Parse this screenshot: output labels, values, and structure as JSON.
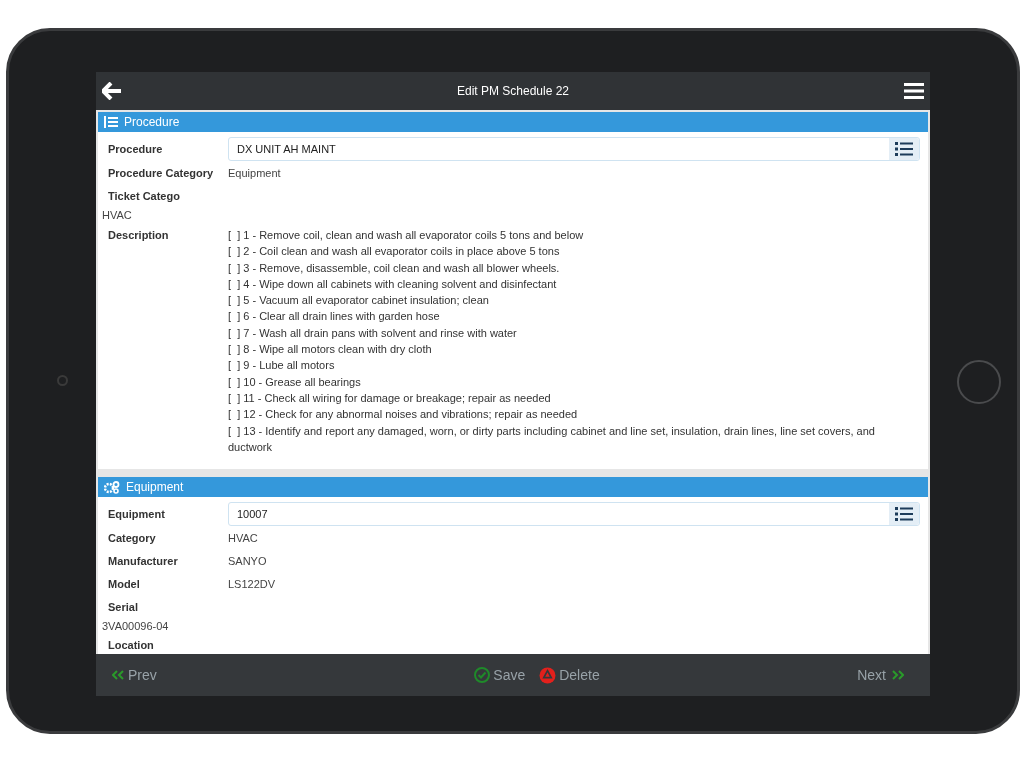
{
  "header": {
    "title": "Edit PM Schedule 22"
  },
  "sections": [
    {
      "title": "Procedure",
      "kind": "list",
      "fields": [
        {
          "kind": "lookup",
          "label": "Procedure",
          "value": "DX UNIT AH MAINT"
        },
        {
          "kind": "text",
          "label": "Procedure Category",
          "value": "Equipment"
        },
        {
          "kind": "stacked",
          "label": "Ticket Catego",
          "value": "HVAC"
        },
        {
          "kind": "lines",
          "label": "Description",
          "lines": [
            "[  ] 1 - Remove coil, clean and wash all evaporator coils 5 tons and below",
            "[  ] 2 - Coil clean and wash all evaporator coils in place above 5 tons",
            "[  ] 3 - Remove, disassemble, coil clean and wash all blower wheels.",
            "[  ] 4 - Wipe down all cabinets with cleaning solvent and disinfectant",
            "[  ] 5 - Vacuum all evaporator cabinet insulation; clean",
            "[  ] 6 - Clear all drain lines with garden hose",
            "[  ] 7 - Wash all drain pans with solvent and rinse with water",
            "[  ] 8 - Wipe all motors clean with dry cloth",
            "[  ] 9 - Lube all motors",
            "[  ] 10 - Grease all bearings",
            "[  ] 11 - Check all wiring for damage or breakage; repair as needed",
            "[  ] 12 - Check for any abnormal noises and vibrations; repair as needed",
            "[  ] 13 - Identify and report any damaged, worn, or dirty parts including cabinet and line set, insulation, drain lines, line set covers, and ductwork"
          ]
        }
      ]
    },
    {
      "title": "Equipment",
      "kind": "gears",
      "fields": [
        {
          "kind": "lookup",
          "label": "Equipment",
          "value": "10007"
        },
        {
          "kind": "text",
          "label": "Category",
          "value": "HVAC"
        },
        {
          "kind": "text",
          "label": "Manufacturer",
          "value": "SANYO"
        },
        {
          "kind": "text",
          "label": "Model",
          "value": "LS122DV"
        },
        {
          "kind": "stacked",
          "label": "Serial",
          "value": "3VA00096-04"
        },
        {
          "kind": "stacked",
          "label": "Location"
        }
      ]
    }
  ],
  "footer": {
    "prev": "Prev",
    "save": "Save",
    "delete": "Delete",
    "next": "Next"
  }
}
